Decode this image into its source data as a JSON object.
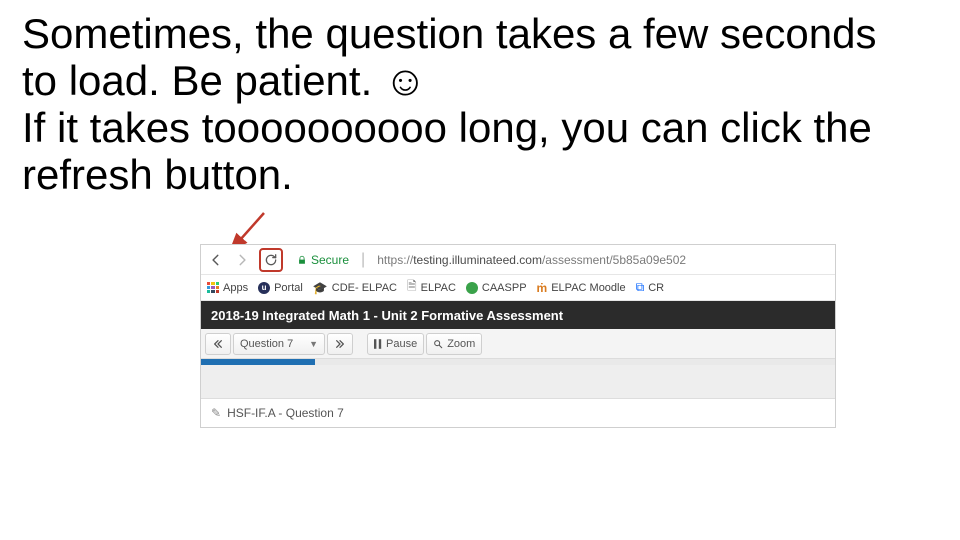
{
  "slide": {
    "line1": "Sometimes, the question takes a few seconds to load.  Be patient. ☺",
    "line2": "If it takes toooooooooo long, you can click the refresh button."
  },
  "browser": {
    "secure_label": "Secure",
    "url_prefix": "https://",
    "url_domain": "testing.illuminateed.com",
    "url_path": "/assessment/5b85a09e502",
    "bookmarks": {
      "apps": "Apps",
      "portal": "Portal",
      "cde_elpac": "CDE- ELPAC",
      "elpac": "ELPAC",
      "caaspp": "CAASPP",
      "elpac_moodle": "ELPAC Moodle",
      "cr": "CR"
    },
    "assessment_title": "2018-19 Integrated Math 1 - Unit 2 Formative Assessment",
    "toolbar": {
      "question_label": "Question 7",
      "pause_label": "Pause",
      "zoom_label": "Zoom"
    },
    "question_header": "HSF-IF.A - Question 7"
  }
}
